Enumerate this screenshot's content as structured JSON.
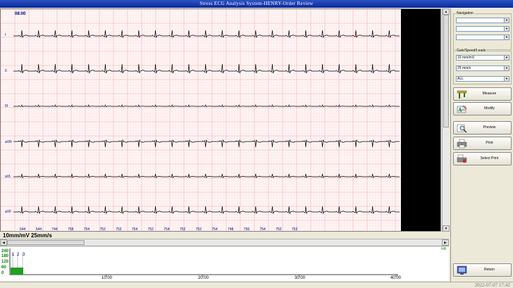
{
  "window": {
    "title": "Stress ECG Analysis System-HENRY-Order Review"
  },
  "ecg": {
    "timestamp": "08:00",
    "scale": "10mm/mV  25mm/s",
    "leads": [
      "I",
      "II",
      "III",
      "aVR",
      "aVL",
      "aVF"
    ],
    "rr_intervals": [
      "544",
      "544",
      "744",
      "758",
      "754",
      "752",
      "752",
      "754",
      "752",
      "754",
      "752",
      "752",
      "754",
      "748",
      "756",
      "754",
      "752",
      "752"
    ]
  },
  "trend": {
    "label": "HR",
    "y_ticks": [
      "240",
      "180",
      "120",
      "60",
      "0"
    ],
    "x_ticks": [
      "10:00",
      "20:00",
      "30:00",
      "40:00"
    ],
    "stages": [
      "1",
      "2",
      "3"
    ]
  },
  "panel": {
    "navigation_title": "Navigation",
    "navigation_selects": [
      "",
      "",
      ""
    ],
    "gain_title": "Gain/Speed/Leads",
    "gain_value": "10 mm/mV",
    "speed_value": "25 mm/s",
    "leads_value": "ALL",
    "buttons": {
      "measure": "Measure",
      "modify": "Modify",
      "preview": "Preview",
      "print": "Print",
      "select_print": "Select Print",
      "return": "Return"
    }
  },
  "status": {
    "datetime": "2022-07-07  17:42"
  },
  "colors": {
    "grid_major": "#f0a8a8",
    "grid_minor": "#fbe0e0",
    "trace": "#000000",
    "label": "#000080",
    "hr_bar": "#1fa01f"
  }
}
